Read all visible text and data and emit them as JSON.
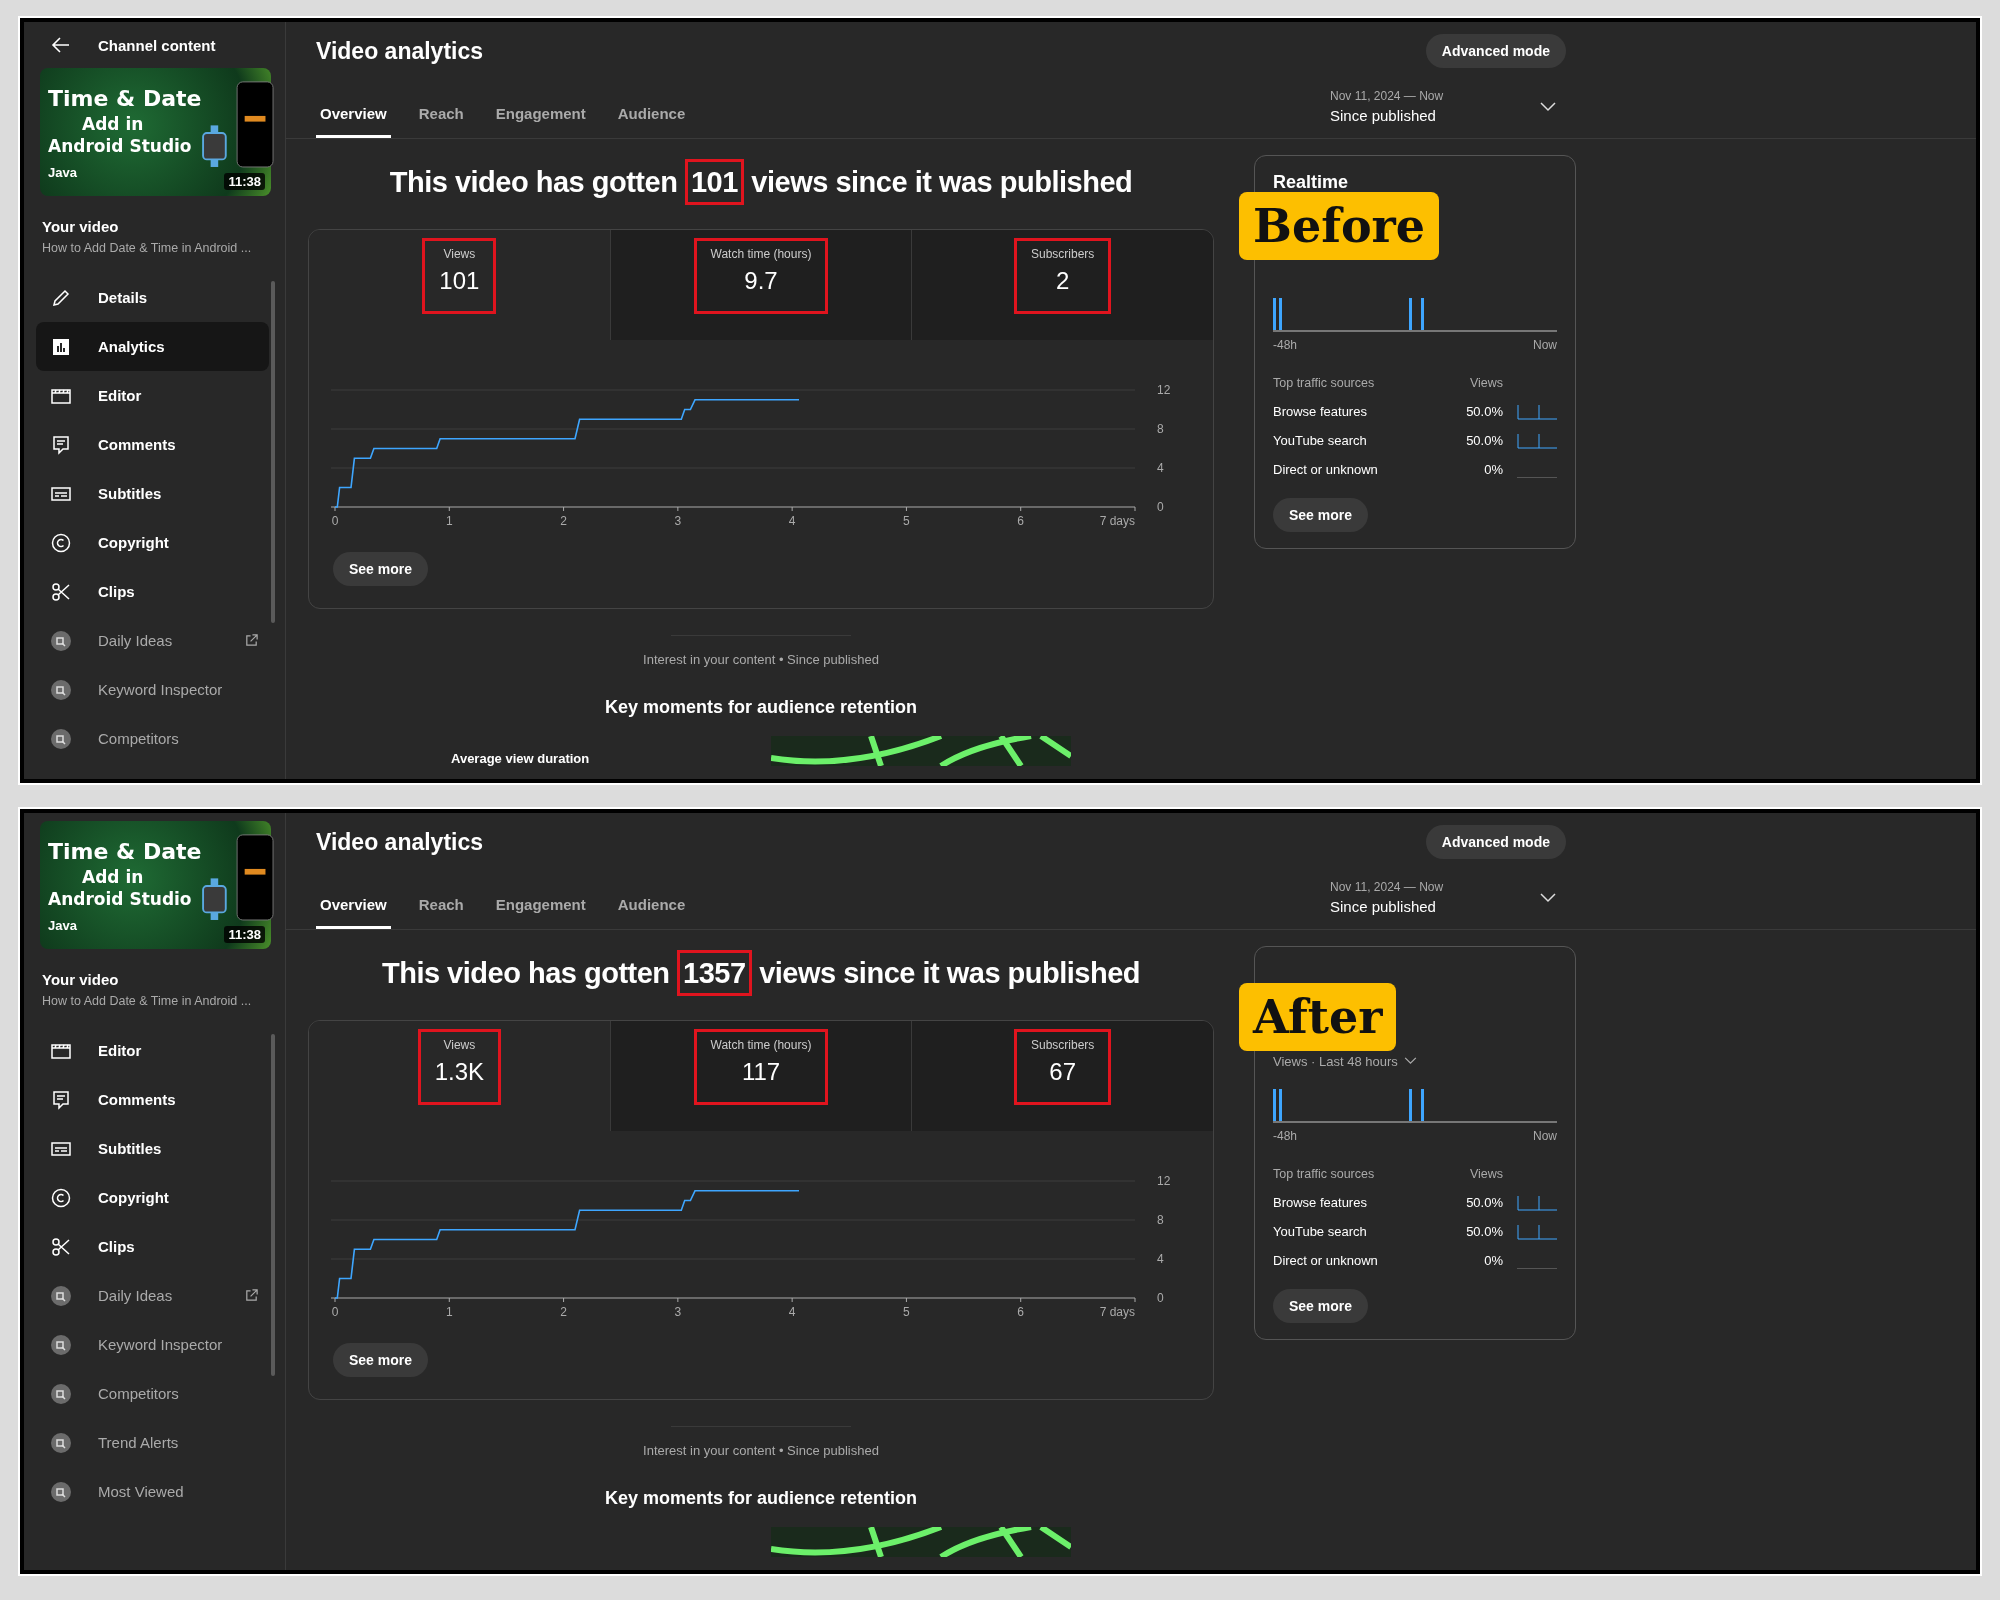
{
  "panels": [
    {
      "badge": "Before",
      "sidebar": {
        "back_label": "Channel content",
        "thumbnail": {
          "lines": [
            "Time & Date",
            "Add in",
            "Android Studio"
          ],
          "tag": "Java",
          "duration": "11:38"
        },
        "video_heading": "Your video",
        "video_title": "How to Add Date & Time in Android ...",
        "items": [
          {
            "label": "Details",
            "kind": "pencil",
            "selected": false,
            "external": false
          },
          {
            "label": "Analytics",
            "kind": "analytics",
            "selected": true,
            "external": false
          },
          {
            "label": "Editor",
            "kind": "film",
            "selected": false,
            "external": false
          },
          {
            "label": "Comments",
            "kind": "comment",
            "selected": false,
            "external": false
          },
          {
            "label": "Subtitles",
            "kind": "subtitles",
            "selected": false,
            "external": false
          },
          {
            "label": "Copyright",
            "kind": "copyright",
            "selected": false,
            "external": false
          },
          {
            "label": "Clips",
            "kind": "scissors",
            "selected": false,
            "external": false
          },
          {
            "label": "Daily Ideas",
            "kind": "extension",
            "selected": false,
            "external": true
          },
          {
            "label": "Keyword Inspector",
            "kind": "extension",
            "selected": false,
            "external": false
          },
          {
            "label": "Competitors",
            "kind": "extension",
            "selected": false,
            "external": false
          }
        ]
      },
      "header": {
        "title": "Video analytics",
        "advanced_button": "Advanced mode"
      },
      "tabs": [
        {
          "label": "Overview",
          "selected": true
        },
        {
          "label": "Reach",
          "selected": false
        },
        {
          "label": "Engagement",
          "selected": false
        },
        {
          "label": "Audience",
          "selected": false
        }
      ],
      "date_range": {
        "range": "Nov 11, 2024 — Now",
        "label": "Since published"
      },
      "headline": {
        "before": "This video has gotten",
        "number": "101",
        "after": "views since it was published",
        "highlighted": true
      },
      "metrics": [
        {
          "label": "Views",
          "value": "101",
          "selected": true,
          "highlighted": true
        },
        {
          "label": "Watch time (hours)",
          "value": "9.7",
          "selected": false,
          "highlighted": true
        },
        {
          "label": "Subscribers",
          "value": "2",
          "selected": false,
          "highlighted": true
        }
      ],
      "chart_data": {
        "type": "line",
        "x": [
          0,
          0.02,
          0.04,
          0.14,
          0.17,
          0.31,
          0.34,
          0.89,
          0.92,
          2.1,
          2.14,
          3.03,
          3.06,
          3.11,
          3.15,
          4.06
        ],
        "series": [
          {
            "color": "#3ea6ff",
            "values": [
              0,
              0,
              2,
              2,
              5,
              5,
              6,
              6,
              7,
              7,
              9,
              9,
              10,
              10,
              11,
              11
            ]
          }
        ],
        "xlim": [
          0,
          7
        ],
        "ylim": [
          0,
          12
        ],
        "xticks": [
          0,
          1,
          2,
          3,
          4,
          5,
          6,
          {
            "value": 7,
            "label": "7 days"
          }
        ],
        "yticks": [
          0,
          4,
          8,
          12
        ]
      },
      "see_more": "See more",
      "realtime": {
        "title": "Realtime",
        "axis_start": "-48h",
        "axis_end": "Now",
        "sources_heading": "Top traffic sources",
        "views_heading": "Views",
        "sources": [
          {
            "name": "Browse features",
            "share": "50.0%",
            "kind": "spikes"
          },
          {
            "name": "YouTube search",
            "share": "50.0%",
            "kind": "spikes"
          },
          {
            "name": "Direct or unknown",
            "share": "0%",
            "kind": "flat"
          }
        ],
        "see_more": "See more"
      },
      "interest": "Interest in your content • Since published",
      "key_moments": "Key moments for audience retention",
      "avg_duration": "Average view duration"
    },
    {
      "badge": "After",
      "sidebar": {
        "thumbnail": {
          "lines": [
            "Time & Date",
            "Add in",
            "Android Studio"
          ],
          "tag": "Java",
          "duration": "11:38"
        },
        "video_heading": "Your video",
        "video_title": "How to Add Date & Time in Android ...",
        "items": [
          {
            "label": "Editor",
            "kind": "film",
            "selected": false,
            "external": false
          },
          {
            "label": "Comments",
            "kind": "comment",
            "selected": false,
            "external": false
          },
          {
            "label": "Subtitles",
            "kind": "subtitles",
            "selected": false,
            "external": false
          },
          {
            "label": "Copyright",
            "kind": "copyright",
            "selected": false,
            "external": false
          },
          {
            "label": "Clips",
            "kind": "scissors",
            "selected": false,
            "external": false
          },
          {
            "label": "Daily Ideas",
            "kind": "extension",
            "selected": false,
            "external": true
          },
          {
            "label": "Keyword Inspector",
            "kind": "extension",
            "selected": false,
            "external": false
          },
          {
            "label": "Competitors",
            "kind": "extension",
            "selected": false,
            "external": false
          },
          {
            "label": "Trend Alerts",
            "kind": "extension",
            "selected": false,
            "external": false
          },
          {
            "label": "Most Viewed",
            "kind": "extension",
            "selected": false,
            "external": false
          }
        ]
      },
      "header": {
        "title": "Video analytics",
        "advanced_button": "Advanced mode"
      },
      "tabs": [
        {
          "label": "Overview",
          "selected": true
        },
        {
          "label": "Reach",
          "selected": false
        },
        {
          "label": "Engagement",
          "selected": false
        },
        {
          "label": "Audience",
          "selected": false
        }
      ],
      "date_range": {
        "range": "Nov 11, 2024 — Now",
        "label": "Since published"
      },
      "headline": {
        "before": "This video has gotten",
        "number": "1357",
        "after": "views since it was published",
        "highlighted": true
      },
      "metrics": [
        {
          "label": "Views",
          "value": "1.3K",
          "selected": true,
          "highlighted": true
        },
        {
          "label": "Watch time (hours)",
          "value": "117",
          "selected": false,
          "highlighted": true
        },
        {
          "label": "Subscribers",
          "value": "67",
          "selected": false,
          "highlighted": true
        }
      ],
      "chart_data": {
        "type": "line",
        "x": [
          0,
          0.02,
          0.04,
          0.14,
          0.17,
          0.31,
          0.34,
          0.89,
          0.92,
          2.1,
          2.14,
          3.03,
          3.06,
          3.11,
          3.15,
          4.06
        ],
        "series": [
          {
            "color": "#3ea6ff",
            "values": [
              0,
              0,
              2,
              2,
              5,
              5,
              6,
              6,
              7,
              7,
              9,
              9,
              10,
              10,
              11,
              11
            ]
          }
        ],
        "xlim": [
          0,
          7
        ],
        "ylim": [
          0,
          12
        ],
        "xticks": [
          0,
          1,
          2,
          3,
          4,
          5,
          6,
          {
            "value": 7,
            "label": "7 days"
          }
        ],
        "yticks": [
          0,
          4,
          8,
          12
        ]
      },
      "see_more": "See more",
      "realtime": {
        "subtitle": "Views · Last 48 hours",
        "axis_start": "-48h",
        "axis_end": "Now",
        "sources_heading": "Top traffic sources",
        "views_heading": "Views",
        "sources": [
          {
            "name": "Browse features",
            "share": "50.0%",
            "kind": "spikes"
          },
          {
            "name": "YouTube search",
            "share": "50.0%",
            "kind": "spikes"
          },
          {
            "name": "Direct or unknown",
            "share": "0%",
            "kind": "flat"
          }
        ],
        "see_more": "See more"
      },
      "interest": "Interest in your content • Since published",
      "key_moments": "Key moments for audience retention"
    }
  ]
}
